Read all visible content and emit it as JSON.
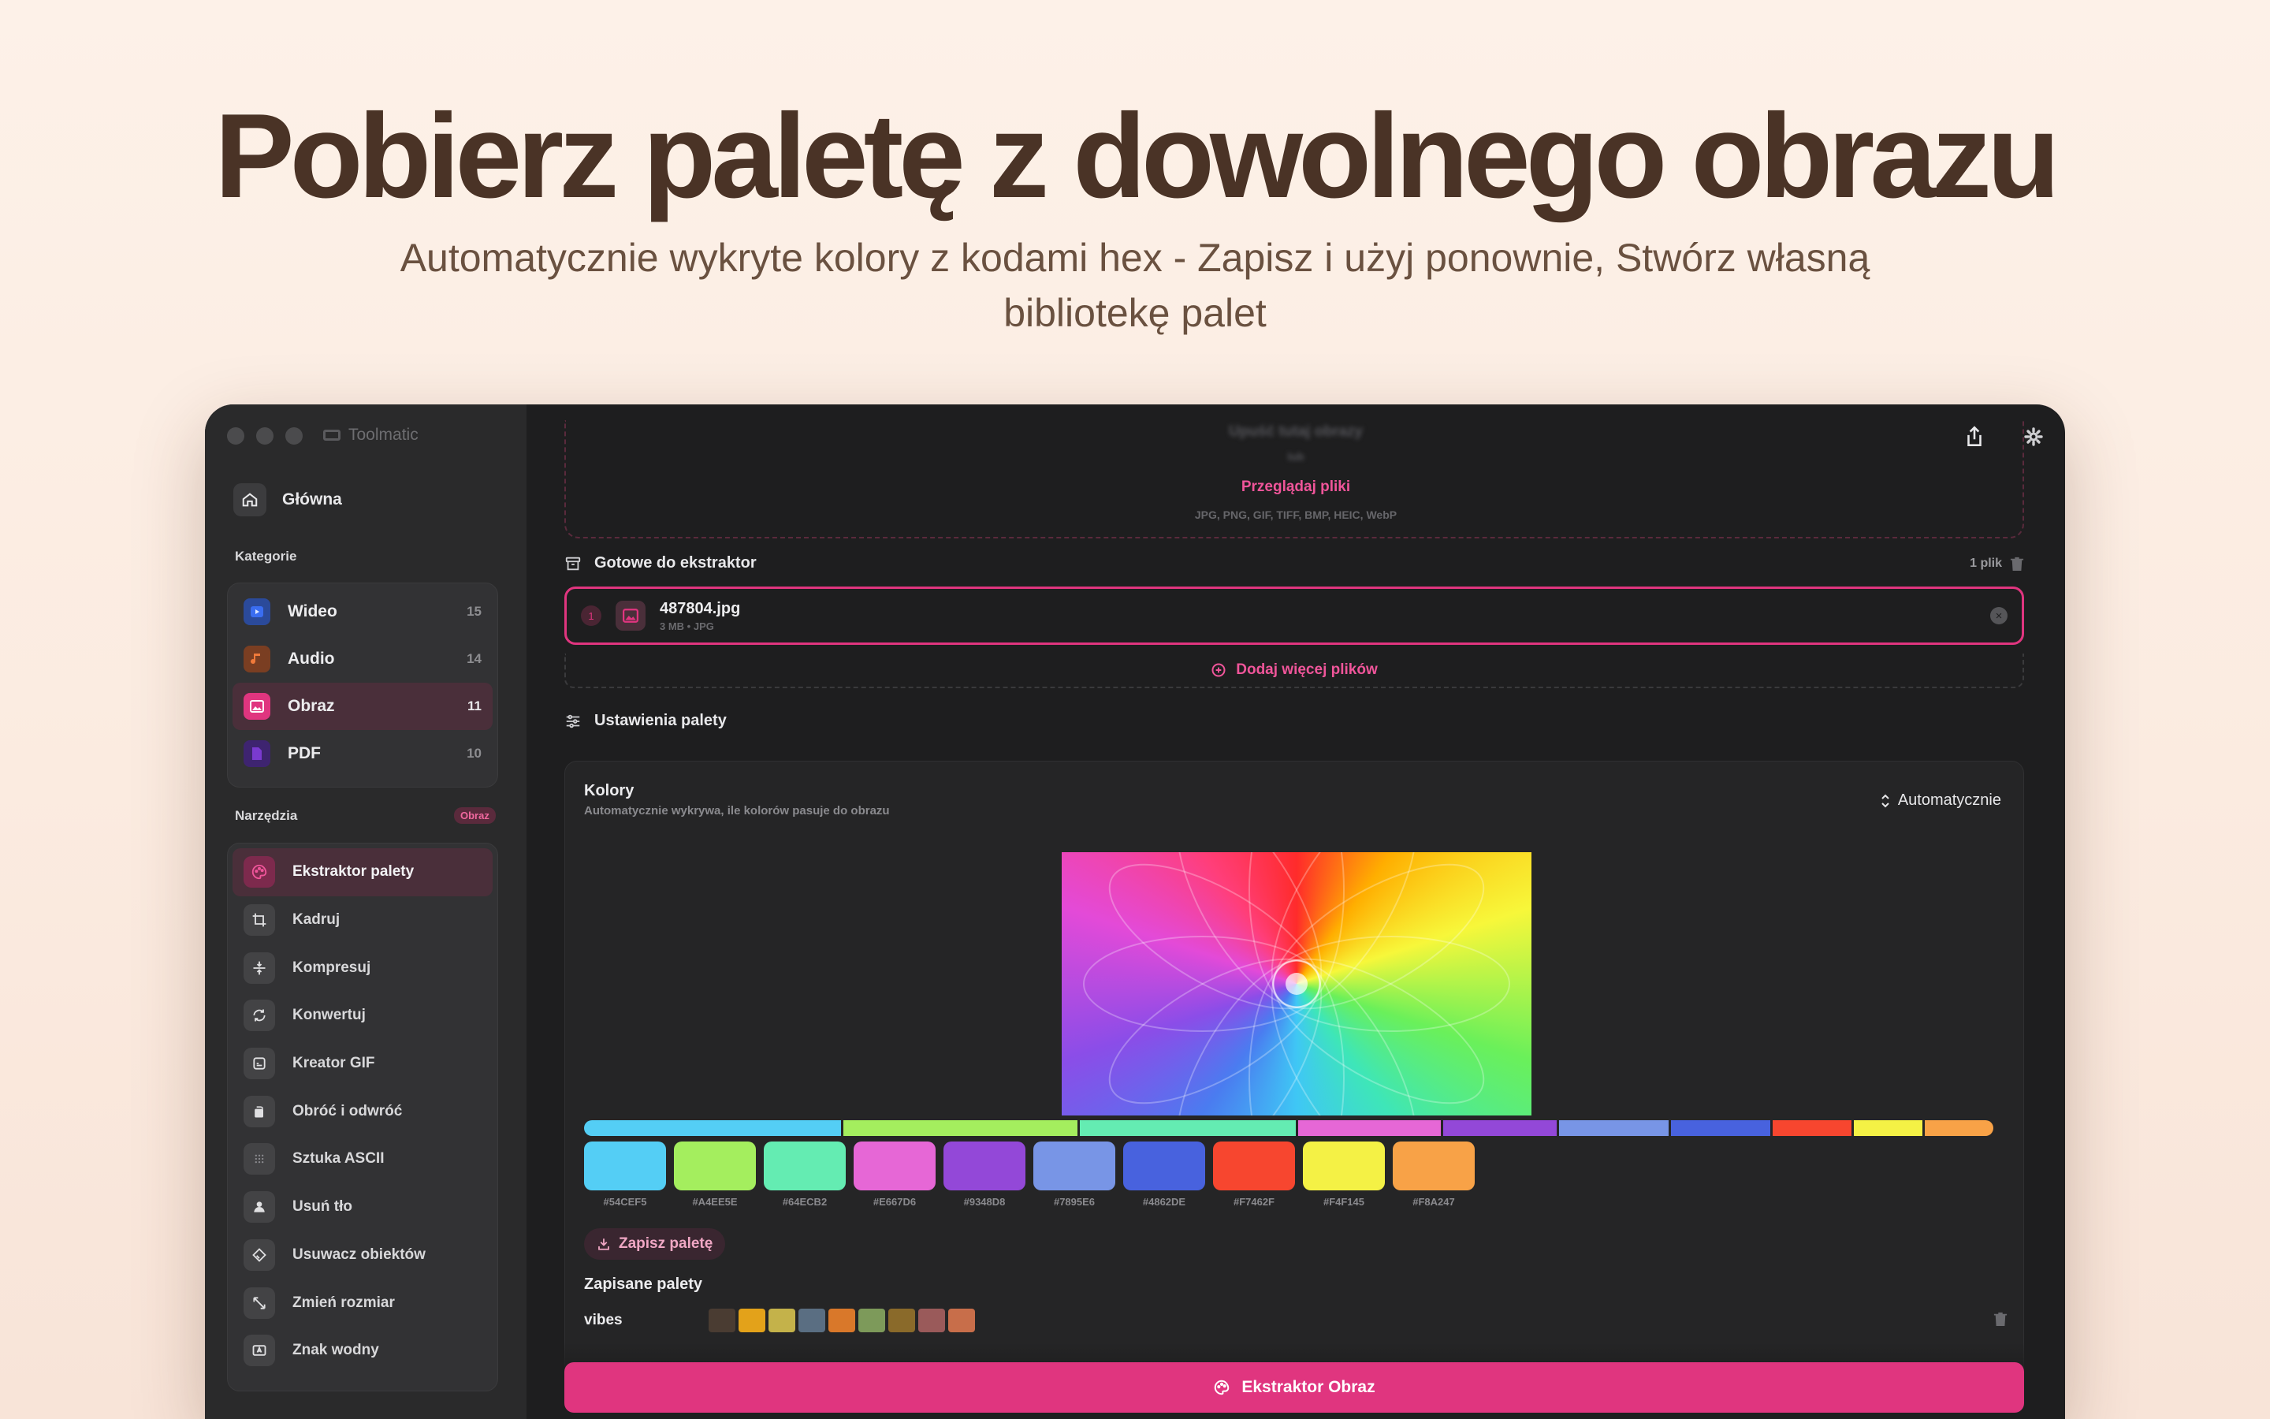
{
  "hero": {
    "title": "Pobierz paletę z dowolnego obrazu",
    "subtitle": "Automatycznie wykryte kolory z kodami hex - Zapisz i użyj ponownie, Stwórz własną bibliotekę palet"
  },
  "window": {
    "app_name": "Toolmatic"
  },
  "sidebar": {
    "home_label": "Główna",
    "categories_label": "Kategorie",
    "categories": [
      {
        "label": "Wideo",
        "count": "15",
        "icon": "video-icon",
        "color": "#3a6df0"
      },
      {
        "label": "Audio",
        "count": "14",
        "icon": "music-note-icon",
        "color": "#f07a3a"
      },
      {
        "label": "Obraz",
        "count": "11",
        "icon": "image-icon",
        "color": "#e0357f"
      },
      {
        "label": "PDF",
        "count": "10",
        "icon": "document-icon",
        "color": "#7a3ad0"
      }
    ],
    "tools_label": "Narzędzia",
    "tools_badge": "Obraz",
    "tools": [
      {
        "label": "Ekstraktor palety",
        "icon": "palette-icon"
      },
      {
        "label": "Kadruj",
        "icon": "crop-icon"
      },
      {
        "label": "Kompresuj",
        "icon": "compress-icon"
      },
      {
        "label": "Konwertuj",
        "icon": "convert-icon"
      },
      {
        "label": "Kreator GIF",
        "icon": "gif-icon"
      },
      {
        "label": "Obróć i odwróć",
        "icon": "rotate-icon"
      },
      {
        "label": "Sztuka ASCII",
        "icon": "ascii-icon"
      },
      {
        "label": "Usuń tło",
        "icon": "person-icon"
      },
      {
        "label": "Usuwacz obiektów",
        "icon": "eraser-icon"
      },
      {
        "label": "Zmień rozmiar",
        "icon": "resize-icon"
      },
      {
        "label": "Znak wodny",
        "icon": "watermark-icon"
      }
    ]
  },
  "drop": {
    "blurred_title": "Upuść tutaj obrazy",
    "blurred_or": "lub",
    "browse_label": "Przeglądaj pliki",
    "formats": "JPG, PNG, GIF, TIFF, BMP, HEIC, WebP"
  },
  "ready": {
    "title": "Gotowe do ekstraktor",
    "count": "1 plik",
    "file": {
      "index": "1",
      "name": "487804.jpg",
      "meta": "3 MB • JPG"
    },
    "add_more_label": "Dodaj więcej plików"
  },
  "settings": {
    "title": "Ustawienia palety",
    "colors_title": "Kolory",
    "colors_desc": "Automatycznie wykrywa, ile kolorów pasuje do obrazu",
    "mode": "Automatycznie"
  },
  "palette": {
    "colors": [
      {
        "hex": "#54CEF5",
        "weight": 0.183
      },
      {
        "hex": "#A4EE5E",
        "weight": 0.167
      },
      {
        "hex": "#64ECB2",
        "weight": 0.154
      },
      {
        "hex": "#E667D6",
        "weight": 0.102
      },
      {
        "hex": "#9348D8",
        "weight": 0.081
      },
      {
        "hex": "#7895E6",
        "weight": 0.078
      },
      {
        "hex": "#4862DE",
        "weight": 0.071
      },
      {
        "hex": "#F7462F",
        "weight": 0.056
      },
      {
        "hex": "#F4F145",
        "weight": 0.049
      },
      {
        "hex": "#F8A247",
        "weight": 0.049
      }
    ],
    "save_label": "Zapisz paletę"
  },
  "saved": {
    "title": "Zapisane palety",
    "items": [
      {
        "name": "vibes",
        "colors": [
          "#4a3c32",
          "#e3a21a",
          "#c4b24a",
          "#5a6e82",
          "#d9782a",
          "#7d9a5a",
          "#8a6a2a",
          "#9a5a5a",
          "#c86e4a"
        ]
      }
    ]
  },
  "cta": {
    "label": "Ekstraktor Obraz"
  },
  "accent": "#e0357f"
}
